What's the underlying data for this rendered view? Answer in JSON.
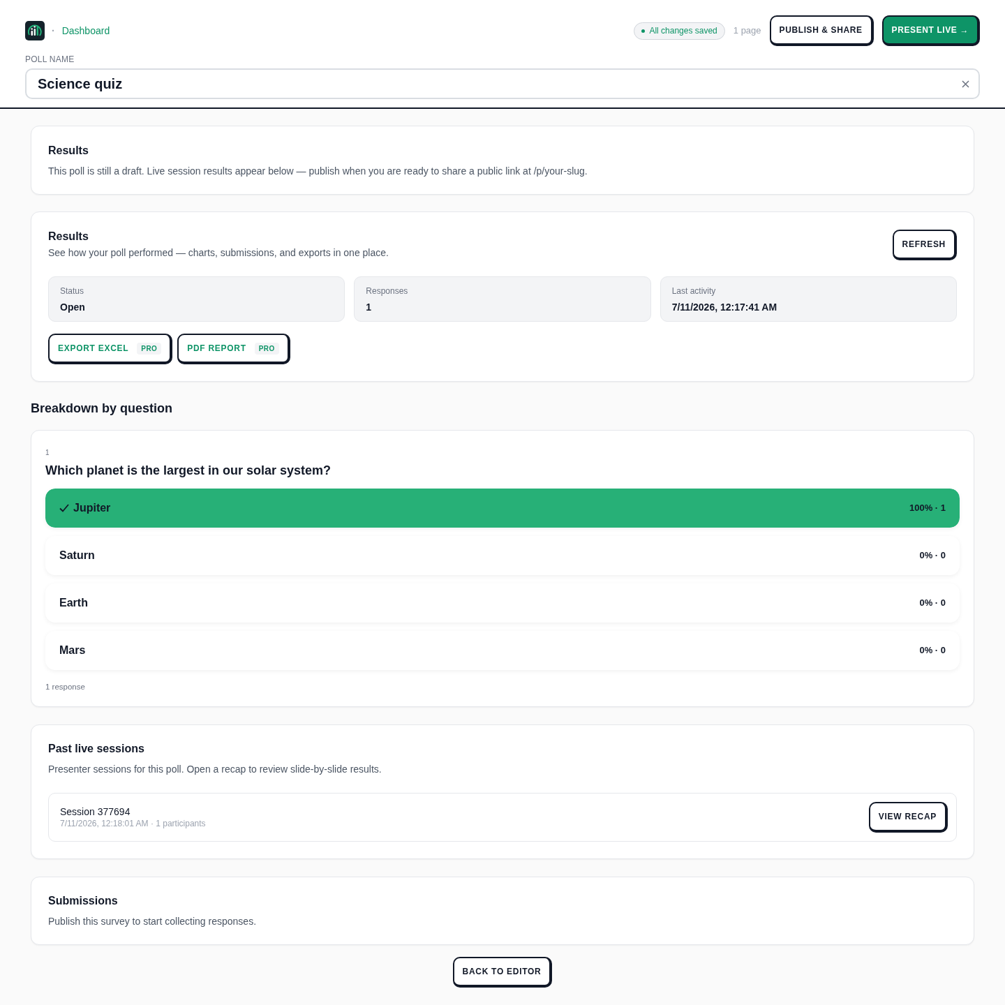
{
  "header": {
    "breadcrumb_separator": "·",
    "breadcrumb": "Dashboard",
    "save_status": "All changes saved",
    "page_count": "1 page",
    "buttons": [
      {
        "label": "PUBLISH & SHARE",
        "kind": "secondary"
      },
      {
        "label": "PRESENT LIVE →",
        "kind": "primary"
      }
    ]
  },
  "poll_name": {
    "label": "POLL NAME",
    "value": "Science quiz"
  },
  "draft_notice": {
    "title": "Results",
    "text": "This poll is still a draft. Live session results appear below — publish when you are ready to share a public link at /p/your-slug."
  },
  "results": {
    "title": "Results",
    "subtitle": "See how your poll performed — charts, submissions, and exports in one place.",
    "refresh_button": "REFRESH",
    "stats": [
      {
        "label": "Status",
        "value": "Open"
      },
      {
        "label": "Responses",
        "value": "1"
      },
      {
        "label": "Last activity",
        "value": "7/11/2026, 12:17:41 AM"
      }
    ],
    "exports": [
      {
        "label": "EXPORT EXCEL",
        "badge": "PRO"
      },
      {
        "label": "PDF REPORT",
        "badge": "PRO"
      }
    ]
  },
  "breakdown": {
    "title": "Breakdown by question",
    "questions": [
      {
        "number": "1",
        "text": "Which planet is the largest in our solar system?",
        "options": [
          {
            "label": "Jupiter",
            "correct": true,
            "level": 1,
            "reading": "100% · 1"
          },
          {
            "label": "Saturn",
            "correct": false,
            "level": 0,
            "reading": "0% · 0"
          },
          {
            "label": "Earth",
            "correct": false,
            "level": 0,
            "reading": "0% · 0"
          },
          {
            "label": "Mars",
            "correct": false,
            "level": 0,
            "reading": "0% · 0"
          }
        ],
        "footer": "1 response"
      }
    ]
  },
  "past_sessions": {
    "title": "Past live sessions",
    "text": "Presenter sessions for this poll. Open a recap to review slide-by-slide results.",
    "sessions": [
      {
        "title": "Session 377694",
        "meta": "7/11/2026, 12:18:01 AM · 1 participants",
        "button": "VIEW RECAP"
      }
    ]
  },
  "submissions": {
    "title": "Submissions",
    "text": "Publish this survey to start collecting responses."
  },
  "back_button": "BACK TO EDITOR"
}
